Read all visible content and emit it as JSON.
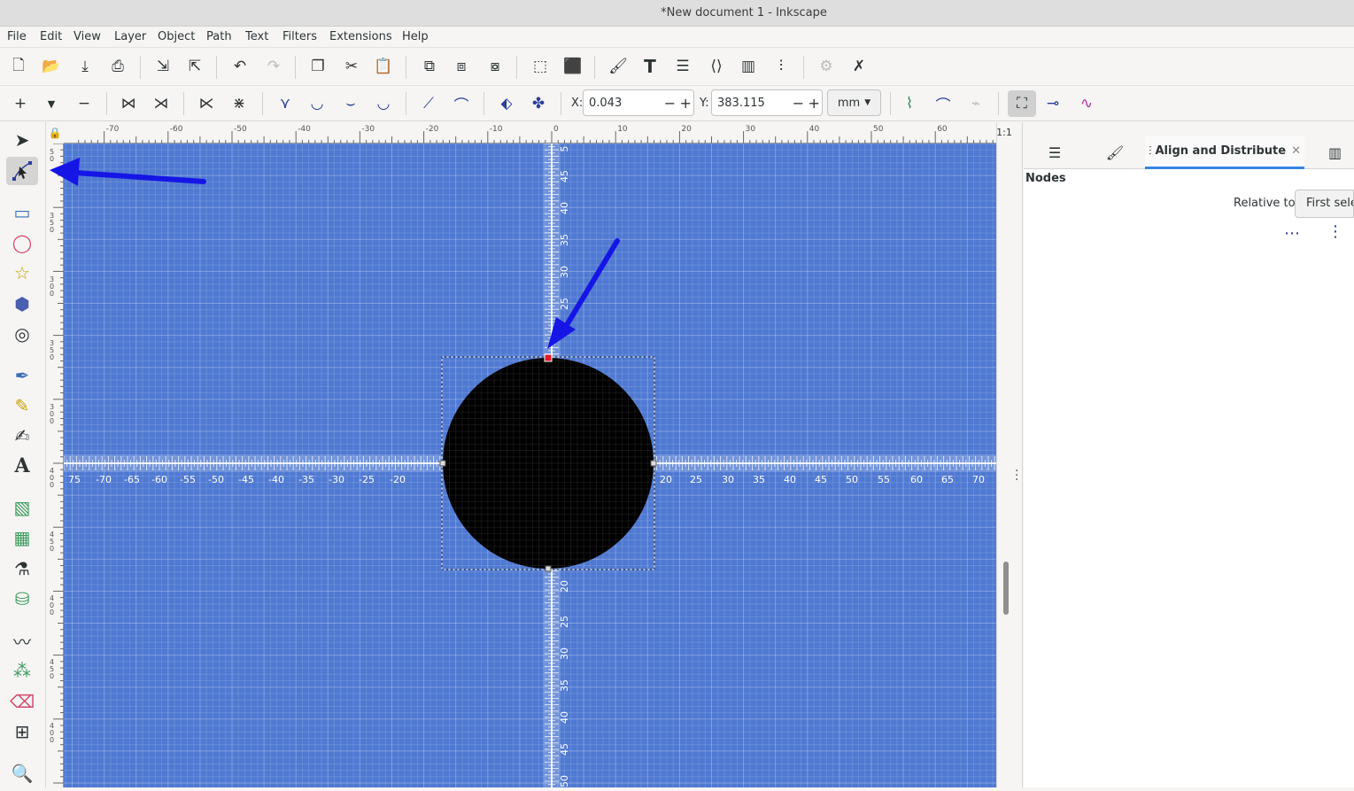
{
  "window": {
    "title": "*New document 1 - Inkscape"
  },
  "menu": [
    "File",
    "Edit",
    "View",
    "Layer",
    "Object",
    "Path",
    "Text",
    "Filters",
    "Extensions",
    "Help"
  ],
  "node_toolbar": {
    "x_label": "X:",
    "x_value": "0.043",
    "y_label": "Y:",
    "y_value": "383.115",
    "unit": "mm",
    "minus": "−",
    "plus": "+"
  },
  "ruler": {
    "top_ticks": [
      "-70",
      "-60",
      "-50",
      "-40",
      "-30",
      "-20",
      "-10",
      "0",
      "10",
      "20",
      "30",
      "40",
      "50",
      "60"
    ],
    "left_ticks": [
      "5\n0",
      "3\n5\n0",
      "3\n0\n0",
      "3\n5\n0",
      "3\n0\n0",
      "4\n0\n0",
      "4\n5\n0",
      "4\n0\n0",
      "4\n5\n0",
      "4\n0\n0"
    ]
  },
  "canvas": {
    "background": "#4f79d2",
    "horizontal_guide_labels": [
      "75",
      "-70",
      "-65",
      "-60",
      "-55",
      "-50",
      "-45",
      "-40",
      "-35",
      "-30",
      "-25",
      "-20",
      "20",
      "25",
      "30",
      "35",
      "40",
      "45",
      "50",
      "55",
      "60",
      "65",
      "70"
    ],
    "vertical_guide_labels_top": [
      "5",
      "45",
      "40",
      "35",
      "30",
      "25"
    ],
    "vertical_guide_labels_bottom": [
      "20",
      "25",
      "30",
      "35",
      "40",
      "45",
      "50"
    ],
    "circle_fill": "#000000",
    "selected_node_color": "#e01b24",
    "arrow_color": "#1515e6"
  },
  "dock": {
    "tabs": [
      {
        "icon": "layers-icon"
      },
      {
        "icon": "fill-stroke-icon"
      },
      {
        "label": "Align and Distribute",
        "icon": "align-icon",
        "close": "✕"
      },
      {
        "icon": "objects-icon"
      }
    ],
    "section_title": "Nodes",
    "relative_to_label": "Relative to:",
    "relative_to_value": "First selected"
  },
  "zoom_corner": "1:1"
}
